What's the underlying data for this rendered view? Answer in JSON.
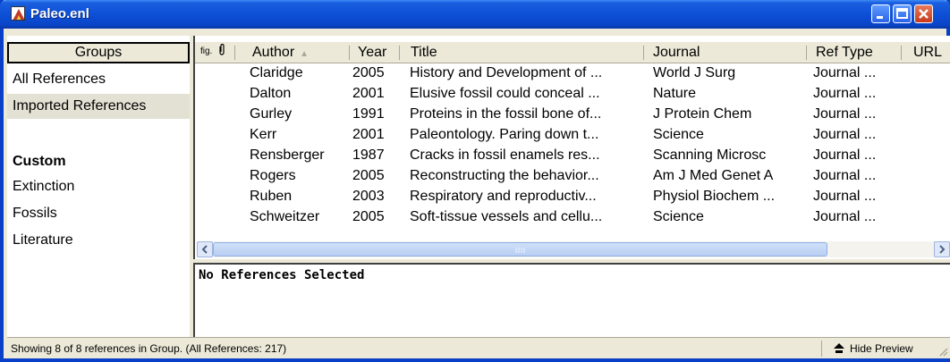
{
  "window": {
    "title": "Paleo.enl",
    "icon": "endnote-app-icon"
  },
  "groups": {
    "header": "Groups",
    "items": [
      {
        "label": "All References"
      },
      {
        "label": "Imported References",
        "selected": true
      }
    ],
    "custom_heading": "Custom",
    "custom_items": [
      {
        "label": "Extinction"
      },
      {
        "label": "Fossils"
      },
      {
        "label": "Literature"
      }
    ]
  },
  "list": {
    "columns": {
      "figure": "fig.",
      "attachment": "attachment-icon",
      "author": "Author",
      "year": "Year",
      "title": "Title",
      "journal": "Journal",
      "ref_type": "Ref Type",
      "url": "URL"
    },
    "sort": {
      "column": "author",
      "direction": "ascending"
    },
    "rows": [
      {
        "author": "Claridge",
        "year": "2005",
        "title": "History and Development of ...",
        "journal": "World J Surg",
        "ref_type": "Journal ..."
      },
      {
        "author": "Dalton",
        "year": "2001",
        "title": "Elusive fossil could conceal ...",
        "journal": "Nature",
        "ref_type": "Journal ..."
      },
      {
        "author": "Gurley",
        "year": "1991",
        "title": "Proteins in the fossil bone of...",
        "journal": "J Protein Chem",
        "ref_type": "Journal ..."
      },
      {
        "author": "Kerr",
        "year": "2001",
        "title": "Paleontology. Paring down t...",
        "journal": "Science",
        "ref_type": "Journal ..."
      },
      {
        "author": "Rensberger",
        "year": "1987",
        "title": "Cracks in fossil enamels res...",
        "journal": "Scanning Microsc",
        "ref_type": "Journal ..."
      },
      {
        "author": "Rogers",
        "year": "2005",
        "title": "Reconstructing the behavior...",
        "journal": "Am J Med Genet A",
        "ref_type": "Journal ..."
      },
      {
        "author": "Ruben",
        "year": "2003",
        "title": "Respiratory and reproductiv...",
        "journal": "Physiol Biochem ...",
        "ref_type": "Journal ..."
      },
      {
        "author": "Schweitzer",
        "year": "2005",
        "title": "Soft-tissue vessels and cellu...",
        "journal": "Science",
        "ref_type": "Journal ..."
      }
    ]
  },
  "preview": {
    "text": "No References Selected"
  },
  "status": {
    "text": "Showing 8 of 8 references in Group. (All References: 217)",
    "hide_preview": "Hide Preview"
  },
  "colors": {
    "titlebar": "#0a46c9",
    "chrome": "#ece9d8",
    "selected_group": "#e3e1d3"
  }
}
